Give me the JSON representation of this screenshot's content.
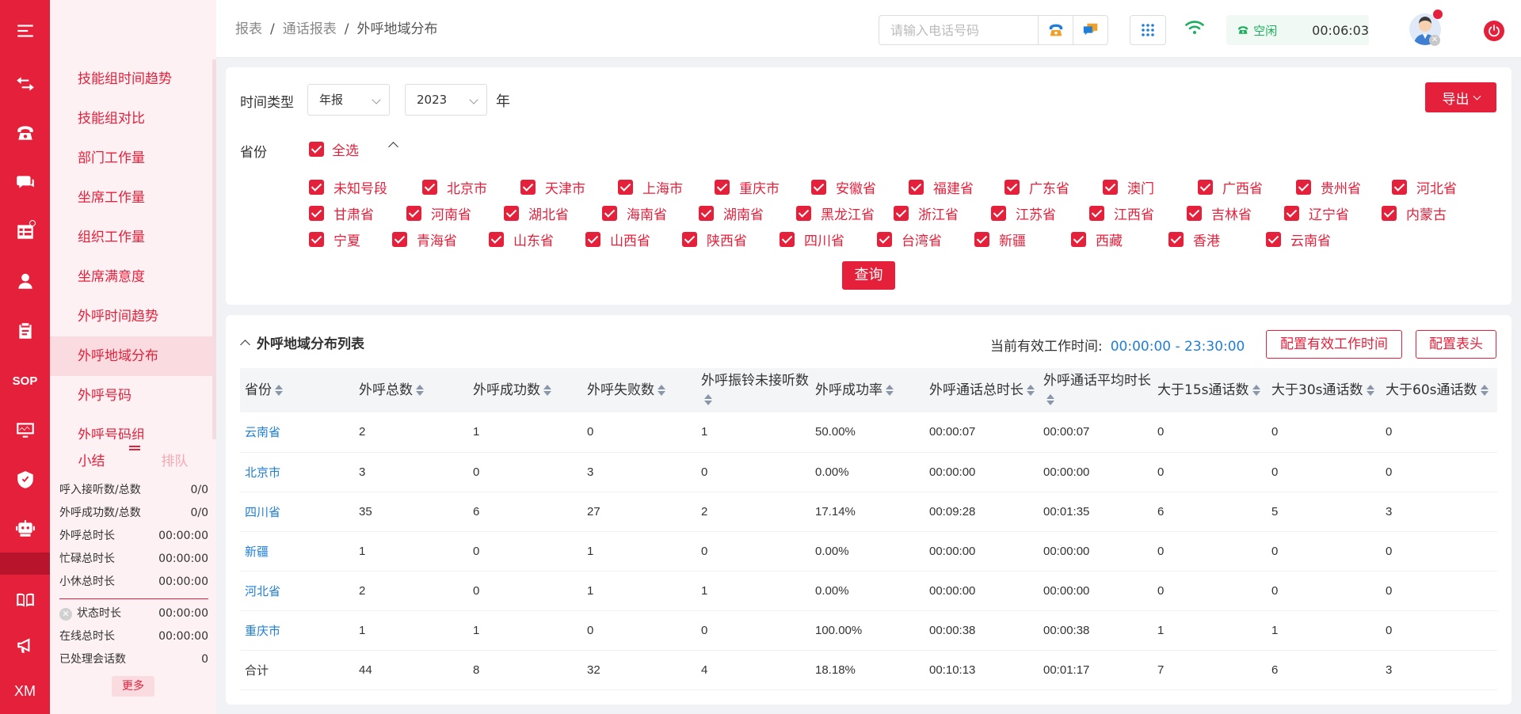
{
  "breadcrumb": {
    "items": [
      "报表",
      "通话报表"
    ],
    "current": "外呼地域分布",
    "sep": "/"
  },
  "search": {
    "placeholder": "请输入电话号码"
  },
  "status": {
    "label": "空闲",
    "timer": "00:06:03"
  },
  "menu": {
    "items": [
      "技能组时间趋势",
      "技能组对比",
      "部门工作量",
      "坐席工作量",
      "组织工作量",
      "坐席满意度",
      "外呼时间趋势",
      "外呼地域分布",
      "外呼号码",
      "外呼号码组"
    ],
    "active_index": 7
  },
  "summary": {
    "tabs": [
      "小结",
      "排队"
    ],
    "rows1": [
      {
        "label": "呼入接听数/总数",
        "value": "0/0"
      },
      {
        "label": "外呼成功数/总数",
        "value": "0/0"
      },
      {
        "label": "外呼总时长",
        "value": "00:00:00"
      },
      {
        "label": "忙碌总时长",
        "value": "00:00:00"
      },
      {
        "label": "小休总时长",
        "value": "00:00:00"
      }
    ],
    "rows2": [
      {
        "label": "状态时长",
        "value": "00:00:00"
      },
      {
        "label": "在线总时长",
        "value": "00:00:00"
      },
      {
        "label": "已处理会话数",
        "value": "0"
      }
    ],
    "more_label": "更多"
  },
  "filter": {
    "time_type_label": "时间类型",
    "time_type_value": "年报",
    "year_value": "2023",
    "year_unit": "年",
    "province_label": "省份",
    "select_all": "全选",
    "export_label": "导出",
    "query_label": "查询",
    "provinces": [
      [
        "未知号段",
        "北京市",
        "天津市",
        "上海市",
        "重庆市",
        "安徽省",
        "福建省",
        "广东省",
        "澳门",
        "广西省",
        "贵州省",
        "河北省"
      ],
      [
        "甘肃省",
        "河南省",
        "湖北省",
        "海南省",
        "湖南省",
        "黑龙江省",
        "浙江省",
        "江苏省",
        "江西省",
        "吉林省",
        "辽宁省",
        "内蒙古"
      ],
      [
        "宁夏",
        "青海省",
        "山东省",
        "山西省",
        "陕西省",
        "四川省",
        "台湾省",
        "新疆",
        "西藏",
        "香港",
        "云南省"
      ]
    ]
  },
  "table": {
    "title": "外呼地域分布列表",
    "work_time_label": "当前有效工作时间:",
    "work_time_value": "00:00:00 - 23:30:00",
    "config_time_btn": "配置有效工作时间",
    "config_header_btn": "配置表头",
    "columns": [
      "省份",
      "外呼总数",
      "外呼成功数",
      "外呼失败数",
      "外呼振铃未接听数",
      "外呼成功率",
      "外呼通话总时长",
      "外呼通话平均时长",
      "大于15s通话数",
      "大于30s通话数",
      "大于60s通话数"
    ],
    "rows": [
      [
        "云南省",
        "2",
        "1",
        "0",
        "1",
        "50.00%",
        "00:00:07",
        "00:00:07",
        "0",
        "0",
        "0"
      ],
      [
        "北京市",
        "3",
        "0",
        "3",
        "0",
        "0.00%",
        "00:00:00",
        "00:00:00",
        "0",
        "0",
        "0"
      ],
      [
        "四川省",
        "35",
        "6",
        "27",
        "2",
        "17.14%",
        "00:09:28",
        "00:01:35",
        "6",
        "5",
        "3"
      ],
      [
        "新疆",
        "1",
        "0",
        "1",
        "0",
        "0.00%",
        "00:00:00",
        "00:00:00",
        "0",
        "0",
        "0"
      ],
      [
        "河北省",
        "2",
        "0",
        "1",
        "1",
        "0.00%",
        "00:00:00",
        "00:00:00",
        "0",
        "0",
        "0"
      ],
      [
        "重庆市",
        "1",
        "1",
        "0",
        "0",
        "100.00%",
        "00:00:38",
        "00:00:38",
        "1",
        "1",
        "0"
      ]
    ],
    "total": [
      "合计",
      "44",
      "8",
      "32",
      "4",
      "18.18%",
      "00:10:13",
      "00:01:17",
      "7",
      "6",
      "3"
    ]
  },
  "rail": {
    "sop_text": "SOP",
    "xm_text": "XM"
  },
  "colors": {
    "brand": "#e5203b",
    "link": "#1f7fd8",
    "idle": "#1aaf5d"
  }
}
